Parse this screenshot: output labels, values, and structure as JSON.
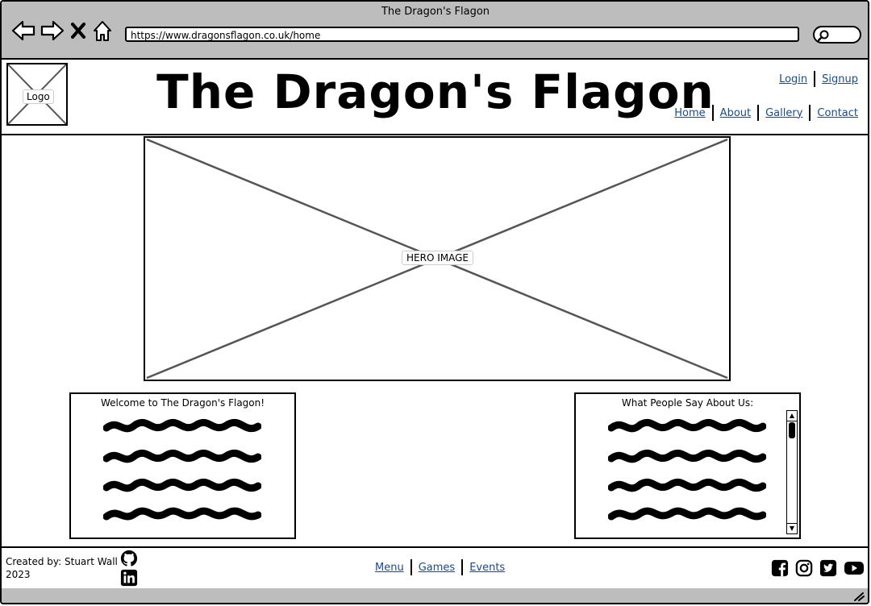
{
  "browser": {
    "window_title": "The Dragon's Flagon",
    "url": "https://www.dragonsflagon.co.uk/home",
    "icons": [
      "back-arrow-icon",
      "forward-arrow-icon",
      "close-icon",
      "home-icon",
      "search-icon"
    ]
  },
  "header": {
    "logo_label": "Logo",
    "site_title": "The Dragon's Flagon",
    "auth_links": [
      "Login",
      "Signup"
    ],
    "nav_links": [
      "Home",
      "About",
      "Gallery",
      "Contact"
    ]
  },
  "hero": {
    "label": "HERO IMAGE"
  },
  "panels": {
    "welcome_title": "Welcome to The Dragon's Flagon!",
    "reviews_title": "What People Say About Us:"
  },
  "footer": {
    "credit_line1": "Created by: Stuart Wall",
    "credit_line2": "2023",
    "links": [
      "Menu",
      "Games",
      "Events"
    ],
    "social_icons": [
      "facebook-icon",
      "instagram-icon",
      "twitter-icon",
      "youtube-icon"
    ]
  }
}
